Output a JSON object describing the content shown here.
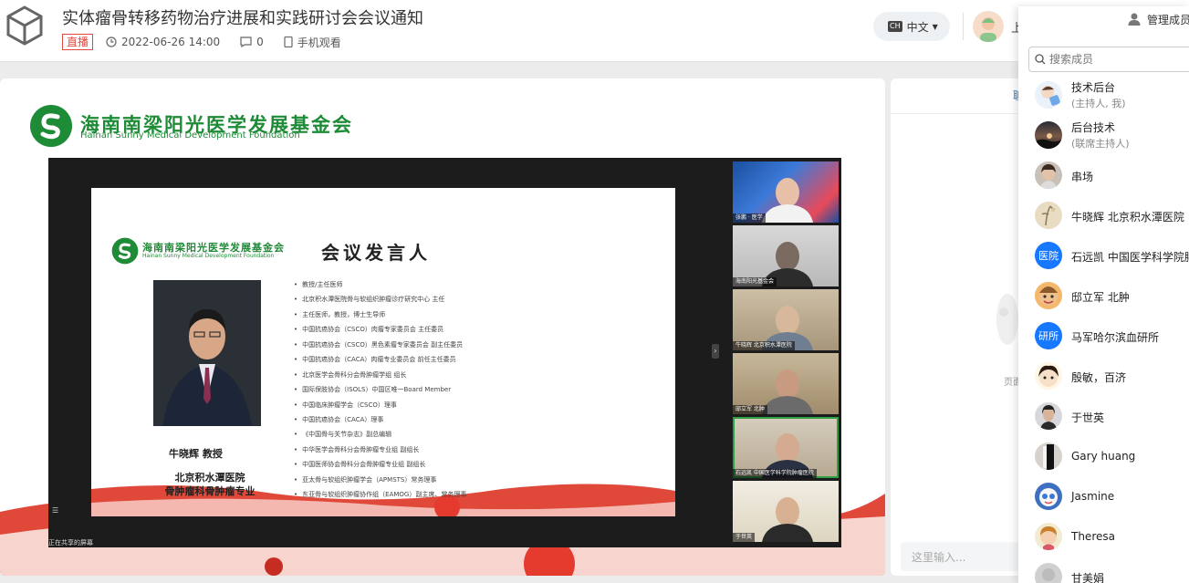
{
  "header": {
    "title": "实体瘤骨转移药物治疗进展和实践研讨会会议通知",
    "badge": "直播",
    "datetime": "2022-06-26 14:00",
    "comments": "0",
    "mobile_label": "手机观看",
    "language": "中文",
    "language_code": "CH",
    "user_initial": "上"
  },
  "stage": {
    "foundation_cn": "海南南梁阳光医学发展基金会",
    "foundation_en": "Hainan Sunny Medical Development Foundation",
    "share_caption": "正在共享的屏幕",
    "slide": {
      "title": "会议发言人",
      "foundation_cn": "海南南梁阳光医学发展基金会",
      "foundation_en": "Hainan Sunny Medical Development Foundation",
      "speaker_name": "牛晓辉 教授",
      "speaker_org_line1": "北京积水潭医院",
      "speaker_org_line2": "骨肿瘤科骨肿瘤专业",
      "bullets": [
        "教授/主任医师",
        "北京积水潭医院骨与软组织肿瘤诊疗研究中心 主任",
        "主任医师，教授，博士生导师",
        "中国抗癌协会（CSCO）肉瘤专家委员会 主任委员",
        "中国抗癌协会（CSCO）黑色素瘤专家委员会 副主任委员",
        "中国抗癌协会（CACA）肉瘤专业委员会 前任主任委员",
        "北京医学会骨科分会骨肿瘤学组 组长",
        "国际保肢协会（ISOLS）中国区唯一Board Member",
        "中国临床肿瘤学会（CSCO）理事",
        "中国抗癌协会（CACA）理事",
        "《中国骨与关节杂志》副总编辑",
        "中华医学会骨科分会骨肿瘤专业组 副组长",
        "中国医师协会骨科分会骨肿瘤专业组 副组长",
        "亚太骨与软组织肿瘤学会（APMSTS）常务理事",
        "东亚骨与软组织肿瘤协作组（EAMOG）副主席、常务理事"
      ]
    },
    "tiles": [
      {
        "caption": "张鹏 · 医学"
      },
      {
        "caption": "海南阳光基金会"
      },
      {
        "caption": "牛晓辉 北京积水潭医院"
      },
      {
        "caption": "邸立军 北肿"
      },
      {
        "caption": "石远凯 中国医学科学院肿瘤医院"
      },
      {
        "caption": "于世英"
      }
    ]
  },
  "chat": {
    "tab_label": "聊",
    "empty_text": "页面",
    "input_placeholder": "这里输入..."
  },
  "panel": {
    "title": "管理成员",
    "search_placeholder": "搜索成员",
    "members": [
      {
        "name": "技术后台",
        "role": "(主持人, 我)",
        "avatar_type": "cartoon"
      },
      {
        "name": "后台技术",
        "role": "(联席主持人)",
        "avatar_type": "landscape"
      },
      {
        "name": "串场",
        "role": "",
        "avatar_type": "photo"
      },
      {
        "name": "牛晓辉 北京积水潭医院",
        "role": "",
        "avatar_type": "photo"
      },
      {
        "name": "石远凯 中国医学科学院肿瘤医院",
        "role": "",
        "avatar_type": "text",
        "avatar_text": "医院",
        "color": "#1677ff"
      },
      {
        "name": "邸立军 北肿",
        "role": "",
        "avatar_type": "cartoon"
      },
      {
        "name": "马军哈尔滨血研所",
        "role": "",
        "avatar_type": "text",
        "avatar_text": "研所",
        "color": "#1677ff"
      },
      {
        "name": "殷敏，百济",
        "role": "",
        "avatar_type": "cartoon"
      },
      {
        "name": "于世英",
        "role": "",
        "avatar_type": "photo"
      },
      {
        "name": "Gary huang",
        "role": "",
        "avatar_type": "photo"
      },
      {
        "name": "Jasmine",
        "role": "",
        "avatar_type": "cartoon"
      },
      {
        "name": "Theresa",
        "role": "",
        "avatar_type": "cartoon"
      },
      {
        "name": "甘美娟",
        "role": "",
        "avatar_type": "photo"
      }
    ]
  }
}
